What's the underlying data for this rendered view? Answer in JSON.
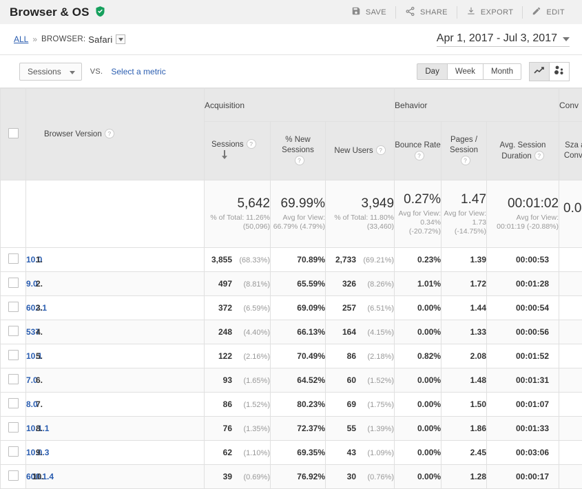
{
  "header": {
    "title": "Browser & OS",
    "verified_icon": "verified-shield-icon",
    "actions": [
      {
        "label": "SAVE",
        "icon": "save-icon"
      },
      {
        "label": "SHARE",
        "icon": "share-icon"
      },
      {
        "label": "EXPORT",
        "icon": "export-icon"
      },
      {
        "label": "EDIT",
        "icon": "edit-pencil-icon"
      }
    ]
  },
  "segment_bar": {
    "all_label": "ALL",
    "separator": "»",
    "segment_prefix": "BROWSER:",
    "segment_value": "Safari",
    "caret_icon": "chevron-down-icon",
    "date_range": "Apr 1, 2017 - Jul 3, 2017",
    "date_caret_icon": "chevron-down-icon"
  },
  "metric_bar": {
    "metric_selected": "Sessions",
    "metric_caret_icon": "chevron-down-icon",
    "vs_label": "VS.",
    "select_metric_link": "Select a metric",
    "granularity": [
      {
        "label": "Day",
        "active": true
      },
      {
        "label": "Week",
        "active": false
      },
      {
        "label": "Month",
        "active": false
      }
    ],
    "viz": [
      {
        "icon": "line-chart-icon",
        "active": true
      },
      {
        "icon": "motion-chart-icon",
        "active": false
      }
    ]
  },
  "table": {
    "groups": [
      {
        "label": "",
        "span": 2
      },
      {
        "label": "Acquisition",
        "span": 3
      },
      {
        "label": "Behavior",
        "span": 3
      },
      {
        "label": "Conv",
        "span": 1
      }
    ],
    "columns": [
      {
        "label": "Browser Version",
        "help": "?",
        "sorted": false
      },
      {
        "label": "Sessions",
        "help": "?",
        "sorted": true,
        "sort_icon": "sort-descending-arrow-icon"
      },
      {
        "label": "% New Sessions",
        "help": "?",
        "sorted": false
      },
      {
        "label": "New Users",
        "help": "?",
        "sorted": false
      },
      {
        "label": "Bounce Rate",
        "help": "?",
        "sorted": false
      },
      {
        "label": "Pages / Session",
        "help": "?",
        "sorted": false
      },
      {
        "label": "Avg. Session Duration",
        "help": "?",
        "sorted": false
      },
      {
        "label": "Sza ad (G Conv Rate",
        "help": "",
        "sorted": false
      }
    ],
    "summary": {
      "sessions": {
        "value": "5,642",
        "sub": "% of Total: 11.26% (50,096)"
      },
      "pct_new_sessions": {
        "value": "69.99%",
        "sub": "Avg for View: 66.79% (4.79%)"
      },
      "new_users": {
        "value": "3,949",
        "sub": "% of Total: 11.80% (33,460)"
      },
      "bounce_rate": {
        "value": "0.27%",
        "sub": "Avg for View: 0.34% (-20.72%)"
      },
      "pages_session": {
        "value": "1.47",
        "sub": "Avg for View: 1.73 (-14.75%)"
      },
      "avg_duration": {
        "value": "00:01:02",
        "sub": "Avg for View: 00:01:19 (-20.88%)"
      },
      "conv_rate": {
        "value": "0.0",
        "sub": "("
      }
    },
    "rows": [
      {
        "index": "1.",
        "version": "10.0",
        "sessions": "3,855",
        "sessions_pct": "(68.33%)",
        "pct_new": "70.89%",
        "new_users": "2,733",
        "new_users_pct": "(69.21%)",
        "bounce": "0.23%",
        "pages": "1.39",
        "duration": "00:00:53"
      },
      {
        "index": "2.",
        "version": "9.0",
        "sessions": "497",
        "sessions_pct": "(8.81%)",
        "pct_new": "65.59%",
        "new_users": "326",
        "new_users_pct": "(8.26%)",
        "bounce": "1.01%",
        "pages": "1.72",
        "duration": "00:01:28"
      },
      {
        "index": "3.",
        "version": "602.1",
        "sessions": "372",
        "sessions_pct": "(6.59%)",
        "pct_new": "69.09%",
        "new_users": "257",
        "new_users_pct": "(6.51%)",
        "bounce": "0.00%",
        "pages": "1.44",
        "duration": "00:00:54"
      },
      {
        "index": "4.",
        "version": "537",
        "sessions": "248",
        "sessions_pct": "(4.40%)",
        "pct_new": "66.13%",
        "new_users": "164",
        "new_users_pct": "(4.15%)",
        "bounce": "0.00%",
        "pages": "1.33",
        "duration": "00:00:56"
      },
      {
        "index": "5.",
        "version": "10.1",
        "sessions": "122",
        "sessions_pct": "(2.16%)",
        "pct_new": "70.49%",
        "new_users": "86",
        "new_users_pct": "(2.18%)",
        "bounce": "0.82%",
        "pages": "2.08",
        "duration": "00:01:52"
      },
      {
        "index": "6.",
        "version": "7.0",
        "sessions": "93",
        "sessions_pct": "(1.65%)",
        "pct_new": "64.52%",
        "new_users": "60",
        "new_users_pct": "(1.52%)",
        "bounce": "0.00%",
        "pages": "1.48",
        "duration": "00:01:31"
      },
      {
        "index": "7.",
        "version": "8.0",
        "sessions": "86",
        "sessions_pct": "(1.52%)",
        "pct_new": "80.23%",
        "new_users": "69",
        "new_users_pct": "(1.75%)",
        "bounce": "0.00%",
        "pages": "1.50",
        "duration": "00:01:07"
      },
      {
        "index": "8.",
        "version": "10.1.1",
        "sessions": "76",
        "sessions_pct": "(1.35%)",
        "pct_new": "72.37%",
        "new_users": "55",
        "new_users_pct": "(1.39%)",
        "bounce": "0.00%",
        "pages": "1.86",
        "duration": "00:01:33"
      },
      {
        "index": "9.",
        "version": "10.0.3",
        "sessions": "62",
        "sessions_pct": "(1.10%)",
        "pct_new": "69.35%",
        "new_users": "43",
        "new_users_pct": "(1.09%)",
        "bounce": "0.00%",
        "pages": "2.45",
        "duration": "00:03:06"
      },
      {
        "index": "10.",
        "version": "600.1.4",
        "sessions": "39",
        "sessions_pct": "(0.69%)",
        "pct_new": "76.92%",
        "new_users": "30",
        "new_users_pct": "(0.76%)",
        "bounce": "0.00%",
        "pages": "1.28",
        "duration": "00:00:17"
      }
    ]
  },
  "colors": {
    "link": "#2a5db0",
    "verified_green": "#16a05d",
    "header_bg": "#e8e8e8",
    "titlebar_bg": "#f1f1f1"
  }
}
